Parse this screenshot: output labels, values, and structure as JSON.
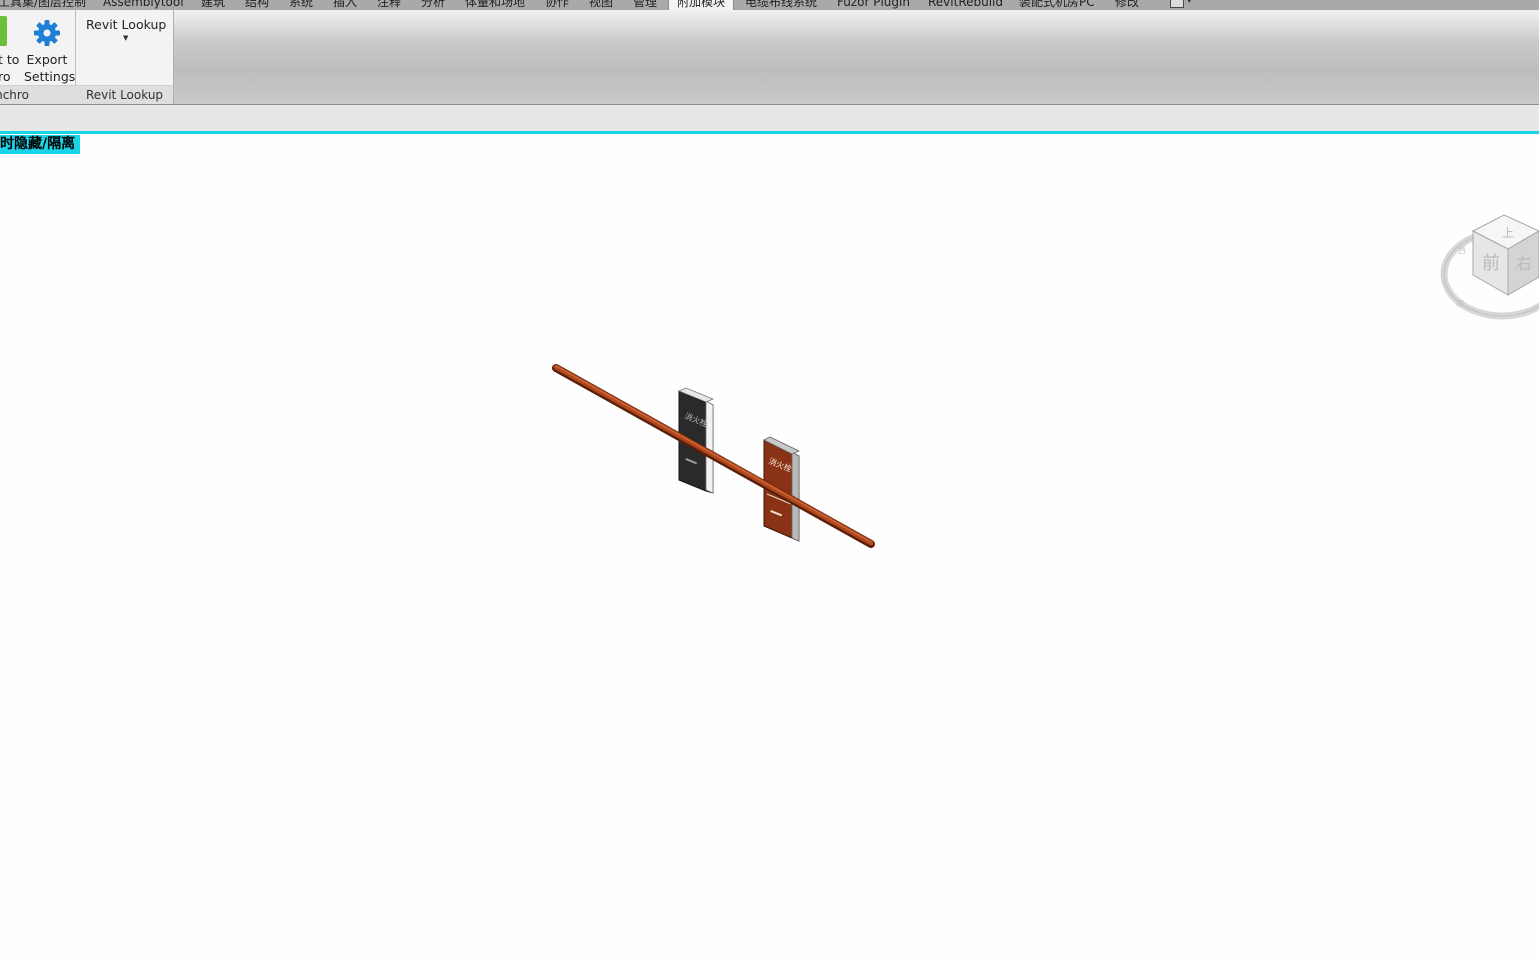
{
  "tabs": [
    {
      "label": "工具集/图层控制"
    },
    {
      "label": "Assemblytool"
    },
    {
      "label": "建筑"
    },
    {
      "label": "结构"
    },
    {
      "label": "系统"
    },
    {
      "label": "插入"
    },
    {
      "label": "注释"
    },
    {
      "label": "分析"
    },
    {
      "label": "体量和场地"
    },
    {
      "label": "协作"
    },
    {
      "label": "视图"
    },
    {
      "label": "管理"
    },
    {
      "label": "附加模块"
    },
    {
      "label": "电缆布线系统"
    },
    {
      "label": "Fuzor Plugin"
    },
    {
      "label": "RevitRebuild"
    },
    {
      "label": "装配式机房PC"
    },
    {
      "label": "修改"
    }
  ],
  "active_tab": "附加模块",
  "ribbon": {
    "synchro": {
      "export_to_label_line1": "t to",
      "export_to_label_line2": "ro",
      "export_settings_line1": "Export",
      "export_settings_line2": "Settings",
      "panel_title": "ynchro"
    },
    "revit_lookup": {
      "button_label": "Revit Lookup",
      "panel_title": "Revit Lookup"
    }
  },
  "viewport": {
    "temp_mode_label": "时隐藏/隔离",
    "viewcube_faces": {
      "top": "上",
      "front": "前",
      "right": "右"
    },
    "viewcube_compass": {
      "left": "西",
      "bottom": "南"
    }
  },
  "model_labels": {
    "cabinet_text": "消火栓"
  },
  "colors": {
    "accent_cyan": "#19d3e6",
    "pipe": "#a8401a",
    "cabinet_dark": "#2a2a2a",
    "cabinet_red": "#8a3216",
    "gear_blue": "#1e7fd6",
    "green_icon": "#6bbf3a"
  }
}
